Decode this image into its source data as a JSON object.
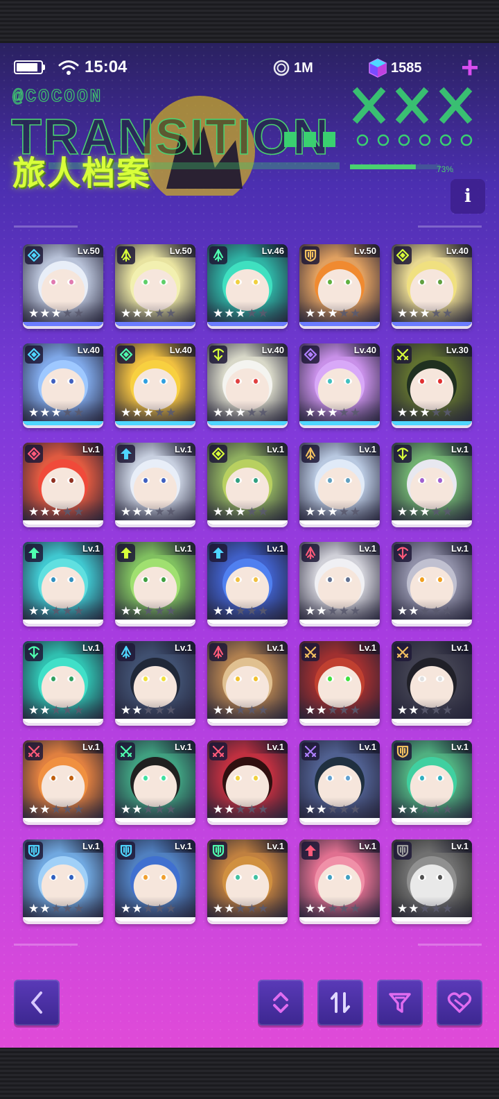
{
  "status_bar": {
    "time": "15:04",
    "battery_level": 1.0
  },
  "resources": {
    "coin_value": "1M",
    "gem_value": "1585",
    "coin_icon": "coin-icon",
    "gem_icon": "gem-icon"
  },
  "header": {
    "title": "旅人档案",
    "banner_text": "TRANSITION",
    "banner_sub": "@COCOON",
    "banner_percent": "73%",
    "banner_progress": 0.73
  },
  "colors": {
    "accent": "#d8ff3a",
    "plus": "#d94ef0"
  },
  "characters": [
    {
      "level": "Lv.50",
      "stars": 3,
      "max_stars": 5,
      "role": "diamond",
      "role_color": "#4fd6ff",
      "bg": "#b8c2d8",
      "hair": "#e8eef8",
      "iris": "#e07ab0",
      "rim": "#6b7cff"
    },
    {
      "level": "Lv.50",
      "stars": 3,
      "max_stars": 5,
      "role": "arrow",
      "role_color": "#d8ff3a",
      "bg": "#e8e3a0",
      "hair": "#f2f0b0",
      "iris": "#5fcf6a",
      "rim": "#6b7cff"
    },
    {
      "level": "Lv.46",
      "stars": 3,
      "max_stars": 5,
      "role": "arrow",
      "role_color": "#4fffb0",
      "bg": "#2fb3a4",
      "hair": "#3fe0c0",
      "iris": "#f0d040",
      "rim": "#6b7cff"
    },
    {
      "level": "Lv.50",
      "stars": 3,
      "max_stars": 5,
      "role": "shield",
      "role_color": "#f2c060",
      "bg": "#e0a060",
      "hair": "#f08a30",
      "iris": "#60b040",
      "rim": "#6b7cff"
    },
    {
      "level": "Lv.40",
      "stars": 3,
      "max_stars": 5,
      "role": "diamond",
      "role_color": "#d8ff3a",
      "bg": "#e8d890",
      "hair": "#f0e080",
      "iris": "#60a040",
      "rim": "#6b7cff"
    },
    {
      "level": "Lv.40",
      "stars": 3,
      "max_stars": 5,
      "role": "diamond",
      "role_color": "#4fd6ff",
      "bg": "#7fa8e8",
      "hair": "#9ec8ff",
      "iris": "#4060c0",
      "rim": "#4fd6ff"
    },
    {
      "level": "Lv.40",
      "stars": 3,
      "max_stars": 5,
      "role": "diamond",
      "role_color": "#4fffb0",
      "bg": "#f0c040",
      "hair": "#f8d040",
      "iris": "#30a0e0",
      "rim": "#4fd6ff"
    },
    {
      "level": "Lv.40",
      "stars": 3,
      "max_stars": 5,
      "role": "bow",
      "role_color": "#d8ff3a",
      "bg": "#d8d8c8",
      "hair": "#f4f4f0",
      "iris": "#e04040",
      "rim": "#4fd6ff"
    },
    {
      "level": "Lv.40",
      "stars": 3,
      "max_stars": 5,
      "role": "diamond",
      "role_color": "#b080ff",
      "bg": "#c890e8",
      "hair": "#d8a8f8",
      "iris": "#40c0c0",
      "rim": "#4fd6ff"
    },
    {
      "level": "Lv.30",
      "stars": 3,
      "max_stars": 5,
      "role": "swords",
      "role_color": "#d8ff3a",
      "bg": "#607030",
      "hair": "#203020",
      "iris": "#e03030",
      "rim": "#4fd6ff"
    },
    {
      "level": "Lv.1",
      "stars": 3,
      "max_stars": 5,
      "role": "diamond",
      "role_color": "#ff5a7a",
      "bg": "#e05a40",
      "hair": "#f04a3a",
      "iris": "#903020",
      "rim": "#ffffff"
    },
    {
      "level": "Lv.1",
      "stars": 3,
      "max_stars": 5,
      "role": "up",
      "role_color": "#4fd6ff",
      "bg": "#c8d0e0",
      "hair": "#e8eef8",
      "iris": "#4060c0",
      "rim": "#ffffff"
    },
    {
      "level": "Lv.1",
      "stars": 3,
      "max_stars": 5,
      "role": "diamond",
      "role_color": "#d8ff3a",
      "bg": "#90b060",
      "hair": "#b8d060",
      "iris": "#30a080",
      "rim": "#ffffff"
    },
    {
      "level": "Lv.1",
      "stars": 3,
      "max_stars": 5,
      "role": "arrow",
      "role_color": "#f2c060",
      "bg": "#b8c8e0",
      "hair": "#e0eaf8",
      "iris": "#60a0c0",
      "rim": "#ffffff"
    },
    {
      "level": "Lv.1",
      "stars": 3,
      "max_stars": 5,
      "role": "bow",
      "role_color": "#d8ff3a",
      "bg": "#70b070",
      "hair": "#e8e8f0",
      "iris": "#a060d0",
      "rim": "#ffffff"
    },
    {
      "level": "Lv.1",
      "stars": 2,
      "max_stars": 5,
      "role": "up",
      "role_color": "#4fffb0",
      "bg": "#40c8d0",
      "hair": "#60e0e0",
      "iris": "#3090c0",
      "rim": "#ffffff"
    },
    {
      "level": "Lv.1",
      "stars": 2,
      "max_stars": 5,
      "role": "up",
      "role_color": "#d8ff3a",
      "bg": "#80c060",
      "hair": "#a0e070",
      "iris": "#40a040",
      "rim": "#ffffff"
    },
    {
      "level": "Lv.1",
      "stars": 2,
      "max_stars": 5,
      "role": "up",
      "role_color": "#4fd6ff",
      "bg": "#4060c8",
      "hair": "#5080f0",
      "iris": "#f0c040",
      "rim": "#ffffff"
    },
    {
      "level": "Lv.1",
      "stars": 2,
      "max_stars": 5,
      "role": "arrow",
      "role_color": "#ff5a7a",
      "bg": "#d0d0d8",
      "hair": "#f0f0f4",
      "iris": "#607090",
      "rim": "#ffffff"
    },
    {
      "level": "Lv.1",
      "stars": 2,
      "max_stars": 5,
      "role": "bow",
      "role_color": "#ff5a7a",
      "bg": "#9090a8",
      "hair": "#c0c0d0",
      "iris": "#f0a020",
      "rim": "#ffffff"
    },
    {
      "level": "Lv.1",
      "stars": 2,
      "max_stars": 5,
      "role": "bow",
      "role_color": "#4fffb0",
      "bg": "#30c0b0",
      "hair": "#40e0c8",
      "iris": "#30a060",
      "rim": "#ffffff"
    },
    {
      "level": "Lv.1",
      "stars": 2,
      "max_stars": 5,
      "role": "arrow",
      "role_color": "#4fd6ff",
      "bg": "#405070",
      "hair": "#202838",
      "iris": "#f0e040",
      "rim": "#ffffff"
    },
    {
      "level": "Lv.1",
      "stars": 2,
      "max_stars": 5,
      "role": "arrow",
      "role_color": "#ff5a7a",
      "bg": "#b08050",
      "hair": "#e0c090",
      "iris": "#f0c030",
      "rim": "#ffffff"
    },
    {
      "level": "Lv.1",
      "stars": 2,
      "max_stars": 5,
      "role": "swords",
      "role_color": "#f2c060",
      "bg": "#a03030",
      "hair": "#c04030",
      "iris": "#40e040",
      "rim": "#ffffff"
    },
    {
      "level": "Lv.1",
      "stars": 2,
      "max_stars": 5,
      "role": "swords",
      "role_color": "#f2c060",
      "bg": "#404050",
      "hair": "#202028",
      "iris": "#e0e0e0",
      "rim": "#ffffff"
    },
    {
      "level": "Lv.1",
      "stars": 2,
      "max_stars": 5,
      "role": "swords",
      "role_color": "#ff5a7a",
      "bg": "#e08040",
      "hair": "#f09040",
      "iris": "#c06010",
      "rim": "#ffffff"
    },
    {
      "level": "Lv.1",
      "stars": 2,
      "max_stars": 5,
      "role": "swords",
      "role_color": "#4fffb0",
      "bg": "#40a080",
      "hair": "#202020",
      "iris": "#40e0a0",
      "rim": "#ffffff"
    },
    {
      "level": "Lv.1",
      "stars": 2,
      "max_stars": 5,
      "role": "swords",
      "role_color": "#ff5a7a",
      "bg": "#c03040",
      "hair": "#301010",
      "iris": "#f0d040",
      "rim": "#ffffff"
    },
    {
      "level": "Lv.1",
      "stars": 2,
      "max_stars": 5,
      "role": "swords",
      "role_color": "#b080ff",
      "bg": "#506090",
      "hair": "#203040",
      "iris": "#60a0d0",
      "rim": "#ffffff"
    },
    {
      "level": "Lv.1",
      "stars": 2,
      "max_stars": 5,
      "role": "shield",
      "role_color": "#f2c060",
      "bg": "#50b080",
      "hair": "#40d0a0",
      "iris": "#30b0c0",
      "rim": "#ffffff"
    },
    {
      "level": "Lv.1",
      "stars": 2,
      "max_stars": 5,
      "role": "shield",
      "role_color": "#4fd6ff",
      "bg": "#70a8e0",
      "hair": "#a0d0f8",
      "iris": "#3060c0",
      "rim": "#ffffff"
    },
    {
      "level": "Lv.1",
      "stars": 2,
      "max_stars": 5,
      "role": "shield",
      "role_color": "#4fd6ff",
      "bg": "#5080c0",
      "hair": "#4070d0",
      "iris": "#f0a030",
      "rim": "#ffffff"
    },
    {
      "level": "Lv.1",
      "stars": 2,
      "max_stars": 5,
      "role": "shield",
      "role_color": "#4fffb0",
      "bg": "#c08040",
      "hair": "#d09040",
      "iris": "#40c0a0",
      "rim": "#ffffff"
    },
    {
      "level": "Lv.1",
      "stars": 2,
      "max_stars": 5,
      "role": "up",
      "role_color": "#ff5a7a",
      "bg": "#e07090",
      "hair": "#f090a8",
      "iris": "#40a0c0",
      "rim": "#ffffff"
    },
    {
      "level": "Lv.1",
      "stars": 2,
      "max_stars": 5,
      "role": "shield",
      "role_color": "#a0a0a0",
      "bg": "#707070",
      "hair": "#909090",
      "iris": "#505050",
      "rim": "#ffffff"
    }
  ],
  "toolbar": {
    "back_icon": "back-icon",
    "sort_order_icon": "sort-order-icon",
    "sort_icon": "sort-icon",
    "filter_icon": "filter-icon",
    "favorite_icon": "favorite-icon"
  }
}
